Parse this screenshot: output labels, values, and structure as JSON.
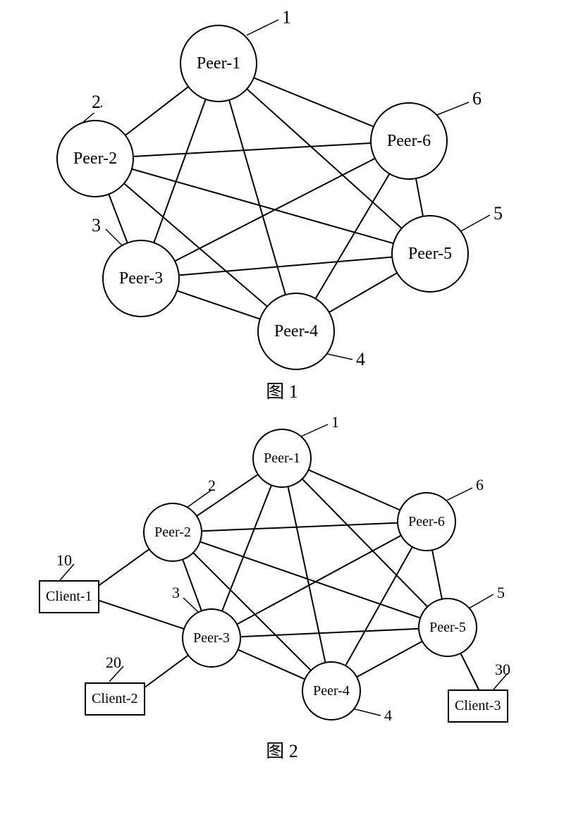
{
  "figure1": {
    "caption": "图 1",
    "nodes": [
      {
        "id": "p1",
        "label": "Peer-1",
        "ref": "1"
      },
      {
        "id": "p2",
        "label": "Peer-2",
        "ref": "2"
      },
      {
        "id": "p3",
        "label": "Peer-3",
        "ref": "3"
      },
      {
        "id": "p4",
        "label": "Peer-4",
        "ref": "4"
      },
      {
        "id": "p5",
        "label": "Peer-5",
        "ref": "5"
      },
      {
        "id": "p6",
        "label": "Peer-6",
        "ref": "6"
      }
    ]
  },
  "figure2": {
    "caption": "图 2",
    "peers": [
      {
        "id": "p1",
        "label": "Peer-1",
        "ref": "1"
      },
      {
        "id": "p2",
        "label": "Peer-2",
        "ref": "2"
      },
      {
        "id": "p3",
        "label": "Peer-3",
        "ref": "3"
      },
      {
        "id": "p4",
        "label": "Peer-4",
        "ref": "4"
      },
      {
        "id": "p5",
        "label": "Peer-5",
        "ref": "5"
      },
      {
        "id": "p6",
        "label": "Peer-6",
        "ref": "6"
      }
    ],
    "clients": [
      {
        "id": "c1",
        "label": "Client-1",
        "ref": "10"
      },
      {
        "id": "c2",
        "label": "Client-2",
        "ref": "20"
      },
      {
        "id": "c3",
        "label": "Client-3",
        "ref": "30"
      }
    ]
  },
  "chart_data": [
    {
      "type": "network",
      "title": "图 1",
      "nodes": [
        "Peer-1",
        "Peer-2",
        "Peer-3",
        "Peer-4",
        "Peer-5",
        "Peer-6"
      ],
      "edges": [
        [
          "Peer-1",
          "Peer-2"
        ],
        [
          "Peer-1",
          "Peer-3"
        ],
        [
          "Peer-1",
          "Peer-4"
        ],
        [
          "Peer-1",
          "Peer-5"
        ],
        [
          "Peer-1",
          "Peer-6"
        ],
        [
          "Peer-2",
          "Peer-3"
        ],
        [
          "Peer-2",
          "Peer-4"
        ],
        [
          "Peer-2",
          "Peer-5"
        ],
        [
          "Peer-2",
          "Peer-6"
        ],
        [
          "Peer-3",
          "Peer-4"
        ],
        [
          "Peer-3",
          "Peer-5"
        ],
        [
          "Peer-3",
          "Peer-6"
        ],
        [
          "Peer-4",
          "Peer-5"
        ],
        [
          "Peer-4",
          "Peer-6"
        ],
        [
          "Peer-5",
          "Peer-6"
        ]
      ],
      "annotations": {
        "Peer-1": "1",
        "Peer-2": "2",
        "Peer-3": "3",
        "Peer-4": "4",
        "Peer-5": "5",
        "Peer-6": "6"
      }
    },
    {
      "type": "network",
      "title": "图 2",
      "nodes": [
        "Peer-1",
        "Peer-2",
        "Peer-3",
        "Peer-4",
        "Peer-5",
        "Peer-6",
        "Client-1",
        "Client-2",
        "Client-3"
      ],
      "edges": [
        [
          "Peer-1",
          "Peer-2"
        ],
        [
          "Peer-1",
          "Peer-3"
        ],
        [
          "Peer-1",
          "Peer-4"
        ],
        [
          "Peer-1",
          "Peer-5"
        ],
        [
          "Peer-1",
          "Peer-6"
        ],
        [
          "Peer-2",
          "Peer-3"
        ],
        [
          "Peer-2",
          "Peer-4"
        ],
        [
          "Peer-2",
          "Peer-5"
        ],
        [
          "Peer-2",
          "Peer-6"
        ],
        [
          "Peer-3",
          "Peer-4"
        ],
        [
          "Peer-3",
          "Peer-5"
        ],
        [
          "Peer-3",
          "Peer-6"
        ],
        [
          "Peer-4",
          "Peer-5"
        ],
        [
          "Peer-4",
          "Peer-6"
        ],
        [
          "Peer-5",
          "Peer-6"
        ],
        [
          "Client-1",
          "Peer-2"
        ],
        [
          "Client-1",
          "Peer-3"
        ],
        [
          "Client-2",
          "Peer-3"
        ],
        [
          "Client-3",
          "Peer-5"
        ]
      ],
      "annotations": {
        "Peer-1": "1",
        "Peer-2": "2",
        "Peer-3": "3",
        "Peer-4": "4",
        "Peer-5": "5",
        "Peer-6": "6",
        "Client-1": "10",
        "Client-2": "20",
        "Client-3": "30"
      }
    }
  ]
}
